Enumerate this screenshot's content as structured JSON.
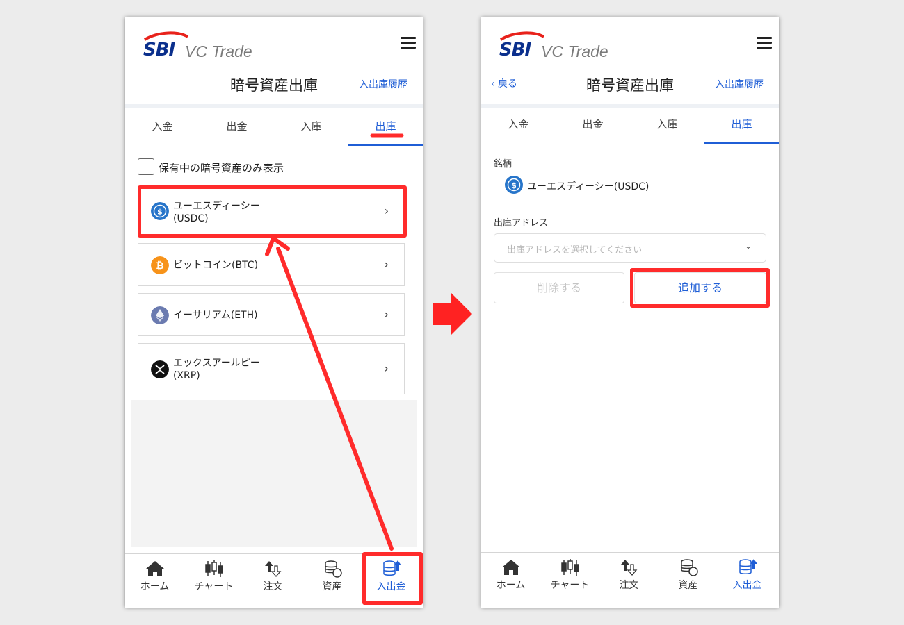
{
  "brand": {
    "logo_mark": "SBI",
    "logo_text": "VC Trade"
  },
  "colors": {
    "accent": "#1f5ed6",
    "highlight": "#ff2b2b",
    "logo": "#0a2f8c",
    "usdc": "#2775ca",
    "btc": "#f7931a",
    "eth": "#6b7bb0",
    "xrp": "#111111"
  },
  "left_screen": {
    "title": "暗号資産出庫",
    "history_link": "入出庫履歴",
    "tabs": [
      {
        "label": "入金"
      },
      {
        "label": "出金"
      },
      {
        "label": "入庫"
      },
      {
        "label": "出庫",
        "active": true
      }
    ],
    "filter_label": "保有中の暗号資産のみ表示",
    "coins": [
      {
        "name_line1": "ユーエスディーシー",
        "name_line2": "(USDC)",
        "icon": "usdc-icon"
      },
      {
        "name_line1": "ビットコイン(BTC)",
        "name_line2": "",
        "icon": "btc-icon"
      },
      {
        "name_line1": "イーサリアム(ETH)",
        "name_line2": "",
        "icon": "eth-icon"
      },
      {
        "name_line1": "エックスアールピー",
        "name_line2": "(XRP)",
        "icon": "xrp-icon"
      }
    ],
    "chevron": "›"
  },
  "right_screen": {
    "back_label": "‹ 戻る",
    "title": "暗号資産出庫",
    "history_link": "入出庫履歴",
    "tabs": [
      {
        "label": "入金"
      },
      {
        "label": "出金"
      },
      {
        "label": "入庫"
      },
      {
        "label": "出庫",
        "active": true
      }
    ],
    "brand_label": "銘柄",
    "selected_coin": "ユーエスディーシー(USDC)",
    "address_label": "出庫アドレス",
    "address_placeholder": "出庫アドレスを選択してください",
    "delete_button": "削除する",
    "add_button": "追加する"
  },
  "bottom_nav": [
    {
      "label": "ホーム",
      "icon": "home-icon"
    },
    {
      "label": "チャート",
      "icon": "candlestick-chart-icon"
    },
    {
      "label": "注文",
      "icon": "order-arrows-icon"
    },
    {
      "label": "資産",
      "icon": "coins-icon"
    },
    {
      "label": "入出金",
      "icon": "deposit-withdraw-icon",
      "active": true
    }
  ]
}
